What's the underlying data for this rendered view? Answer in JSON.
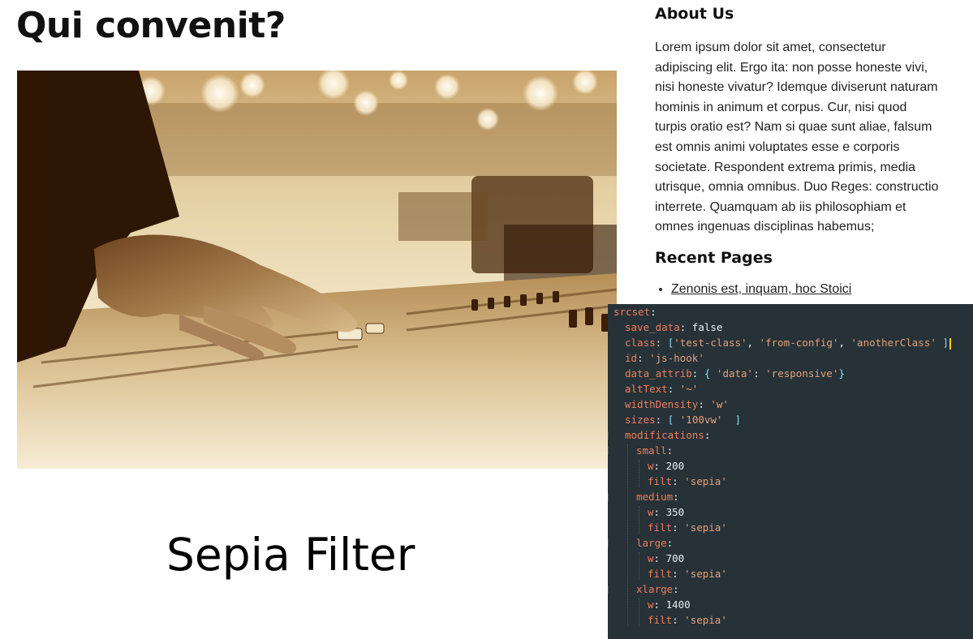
{
  "main": {
    "title": "Qui convenit?",
    "caption": "Sepia Filter"
  },
  "sidebar": {
    "about_title": "About Us",
    "about_text": "Lorem ipsum dolor sit amet, consectetur adipiscing elit. Ergo ita: non posse honeste vivi, nisi honeste vivatur? Idemque diviserunt naturam hominis in animum et corpus. Cur, nisi quod turpis oratio est? Nam si quae sunt aliae, falsum est omnis animi voluptates esse e corporis societate. Respondent extrema primis, media utrisque, omnia omnibus. Duo Reges: constructio interrete. Quamquam ab iis philosophiam et omnes ingenuas disciplinas habemus;",
    "recent_title": "Recent Pages",
    "recent_items": [
      "Zenonis est, inquam, hoc Stoici"
    ]
  },
  "code": {
    "lines": [
      {
        "indent": 0,
        "key": "srcset",
        "value": ""
      },
      {
        "indent": 1,
        "key": "save_data",
        "value": "false",
        "vtype": "v"
      },
      {
        "indent": 1,
        "key": "class",
        "value": "['test-class', 'from-config', 'anotherClass' ]",
        "vtype": "arr",
        "cursor": true
      },
      {
        "indent": 1,
        "key": "id",
        "value": "'js-hook'",
        "vtype": "s"
      },
      {
        "indent": 1,
        "key": "data_attrib",
        "value": "{ 'data': 'responsive'}",
        "vtype": "obj"
      },
      {
        "indent": 1,
        "key": "altText",
        "value": "'~'",
        "vtype": "s"
      },
      {
        "indent": 1,
        "key": "widthDensity",
        "value": "'w'",
        "vtype": "s"
      },
      {
        "indent": 1,
        "key": "sizes",
        "value": "[ '100vw'  ]",
        "vtype": "arr"
      },
      {
        "indent": 1,
        "key": "modifications",
        "value": ""
      },
      {
        "indent": 2,
        "key": "small",
        "value": ""
      },
      {
        "indent": 3,
        "key": "w",
        "value": "200",
        "vtype": "v"
      },
      {
        "indent": 3,
        "key": "filt",
        "value": "'sepia'",
        "vtype": "s"
      },
      {
        "indent": 2,
        "key": "medium",
        "value": ""
      },
      {
        "indent": 3,
        "key": "w",
        "value": "350",
        "vtype": "v"
      },
      {
        "indent": 3,
        "key": "filt",
        "value": "'sepia'",
        "vtype": "s"
      },
      {
        "indent": 2,
        "key": "large",
        "value": ""
      },
      {
        "indent": 3,
        "key": "w",
        "value": "700",
        "vtype": "v"
      },
      {
        "indent": 3,
        "key": "filt",
        "value": "'sepia'",
        "vtype": "s"
      },
      {
        "indent": 2,
        "key": "xlarge",
        "value": ""
      },
      {
        "indent": 3,
        "key": "w",
        "value": "1400",
        "vtype": "v"
      },
      {
        "indent": 3,
        "key": "filt",
        "value": "'sepia'",
        "vtype": "s"
      }
    ]
  },
  "colors": {
    "editor_bg": "#263238",
    "key": "#f07d5a",
    "string": "#e8a077",
    "punct": "#89ddff",
    "sepia_dark": "#3a1d08",
    "sepia_light": "#f3e6c8"
  }
}
